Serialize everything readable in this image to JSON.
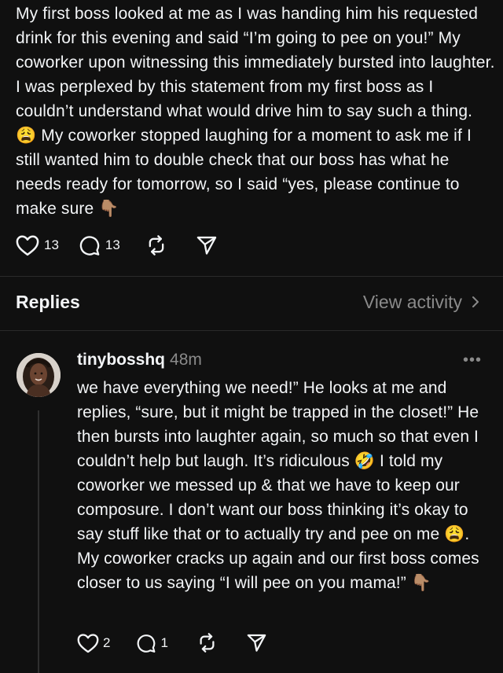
{
  "post": {
    "text": "My first boss looked at me as I was handing him his requested drink for this evening and said “I’m going to pee on you!” My coworker upon witnessing this immediately bursted into laughter. I was perplexed by this statement from my first boss as I couldn’t understand what would drive him to say such a thing. 😩 My coworker stopped laughing for a moment to ask me if I still wanted him to double check that our boss has what he needs ready for tomorrow, so I said “yes, please continue to make sure 👇🏽",
    "likes": "13",
    "comments": "13"
  },
  "replies_section": {
    "title": "Replies",
    "view_activity": "View activity"
  },
  "reply": {
    "username": "tinybosshq",
    "time": "48m",
    "more": "•••",
    "text": "we have everything we need!” He looks at me and replies, “sure, but it might be trapped in the closet!” He then bursts into laughter again, so much so that even I couldn’t help but laugh. It’s ridiculous 🤣 I told my coworker we messed up & that we have to keep our composure. I don’t want our boss thinking it’s okay to say stuff like that or to actually try and pee on me 😩. My coworker cracks up again and our first boss comes closer to us saying “I will pee on you mama!” 👇🏽",
    "likes": "2",
    "comments": "1"
  },
  "colors": {
    "background": "#101010",
    "text": "#f3f5f7",
    "muted": "#8a8a8a",
    "divider": "#2a2a2a"
  },
  "icons": [
    "heart-icon",
    "comment-icon",
    "repost-icon",
    "share-icon",
    "chevron-right-icon",
    "more-icon"
  ]
}
